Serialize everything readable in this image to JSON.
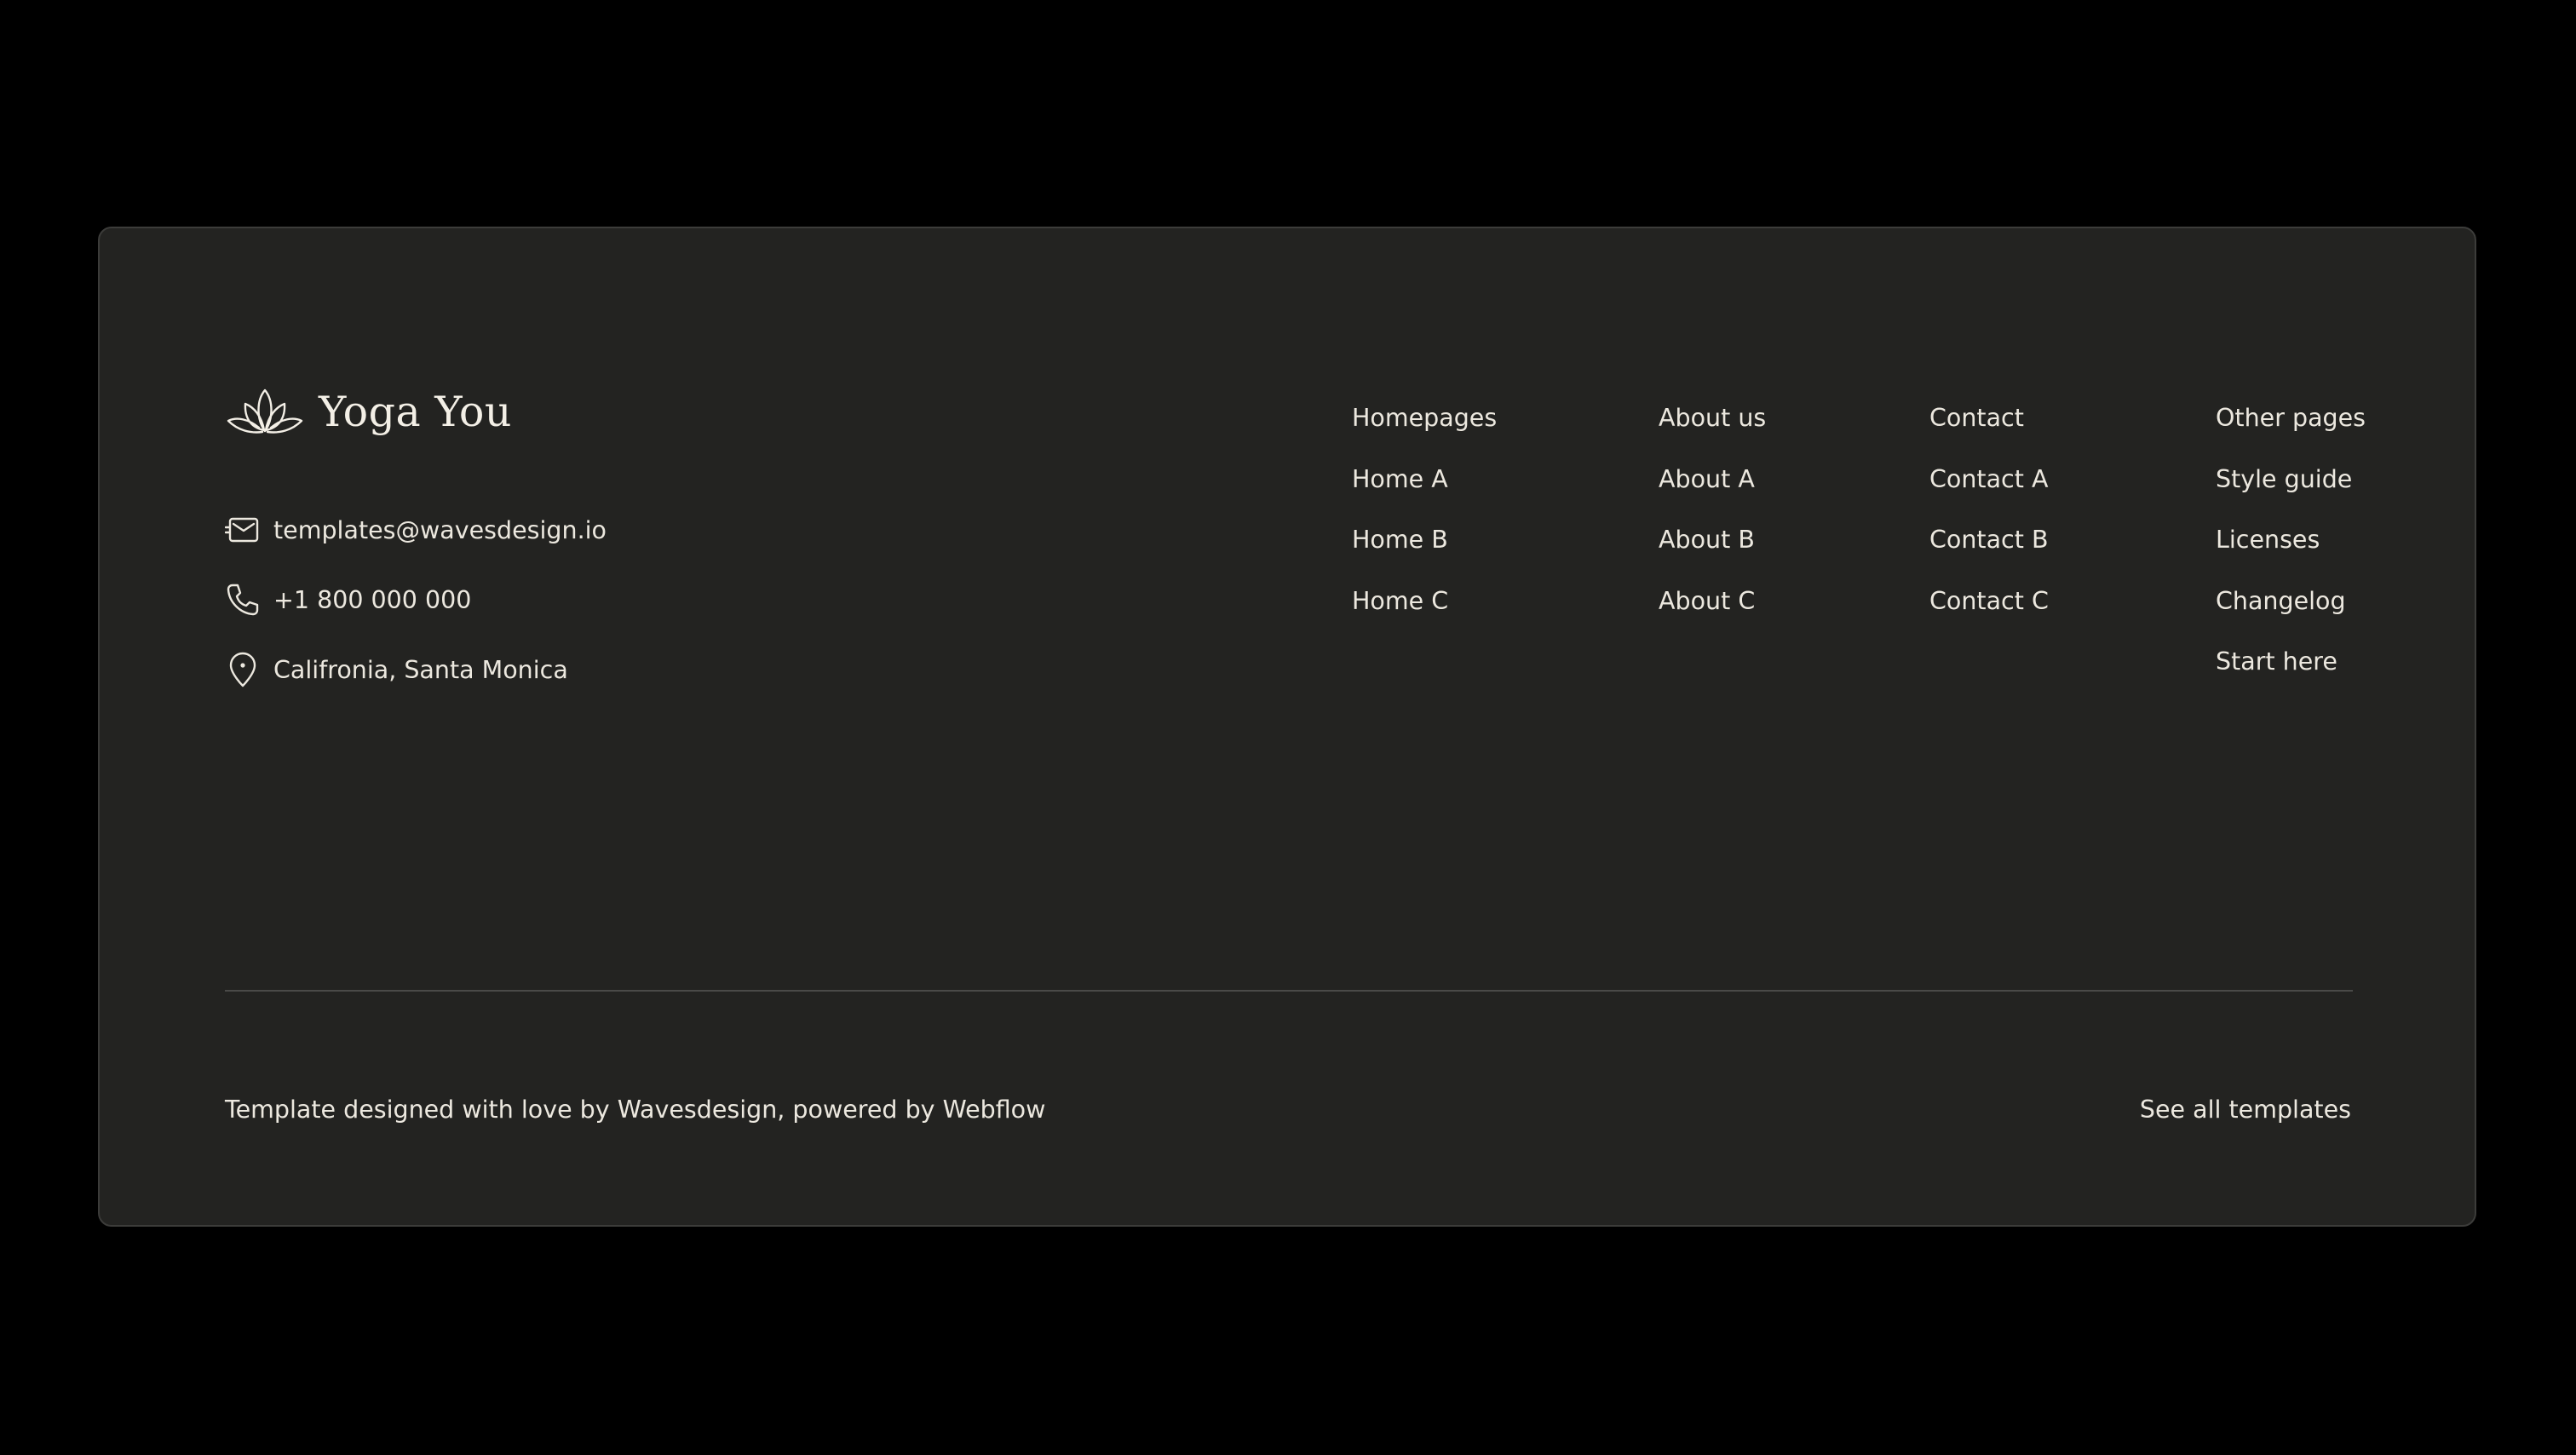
{
  "brand": {
    "name": "Yoga You",
    "icon": "lotus-icon"
  },
  "contact": {
    "email": "templates@wavesdesign.io",
    "email_icon": "mail-icon",
    "phone": "+1 800 000 000",
    "phone_icon": "phone-icon",
    "address": "Califronia, Santa Monica",
    "address_icon": "location-pin-icon"
  },
  "nav": {
    "columns": [
      {
        "heading": "Homepages",
        "links": [
          "Home A",
          "Home B",
          "Home C"
        ]
      },
      {
        "heading": "About us",
        "links": [
          "About A",
          "About B",
          "About C"
        ]
      },
      {
        "heading": "Contact",
        "links": [
          "Contact A",
          "Contact B",
          "Contact C"
        ]
      },
      {
        "heading": "Other pages",
        "links": [
          "Style guide",
          "Licenses",
          "Changelog",
          "Start here"
        ]
      }
    ]
  },
  "bottom": {
    "credit": "Template designed with love by Wavesdesign, powered by Webflow",
    "see_all": "See all templates"
  },
  "colors": {
    "page_background": "#000000",
    "card_background": "#232321",
    "text": "#ece8df"
  }
}
